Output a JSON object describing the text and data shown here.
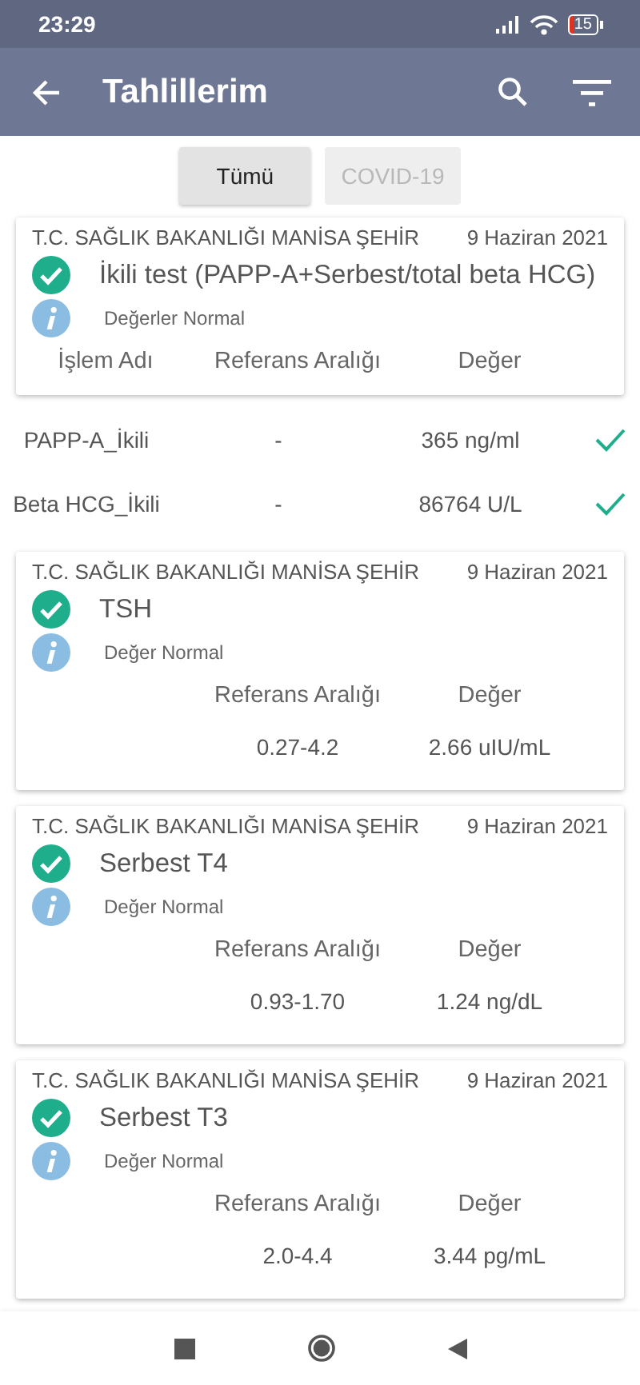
{
  "status_bar": {
    "time": "23:29",
    "battery": "15"
  },
  "app_bar": {
    "title": "Tahlillerim"
  },
  "filters": [
    {
      "label": "Tümü",
      "selected": true
    },
    {
      "label": "COVID-19",
      "selected": false
    }
  ],
  "results": [
    {
      "kind": "panel",
      "hospital": "T.C. SAĞLIK BAKANLIĞI MANİSA ŞEHİR",
      "date": "9 Haziran 2021",
      "normal": true,
      "test": "İkili test (PAPP-A+Serbest/total beta HCG)",
      "note": "Değerler Normal",
      "columns": [
        "İşlem Adı",
        "Referans Aralığı",
        "Değer"
      ],
      "rows": [
        {
          "name": "PAPP-A_İkili",
          "range": "-",
          "value": "365 ng/ml",
          "normal": true
        },
        {
          "name": "Beta HCG_İkili",
          "range": "-",
          "value": "86764 U/L",
          "normal": true
        }
      ]
    },
    {
      "kind": "single",
      "hospital": "T.C. SAĞLIK BAKANLIĞI MANİSA ŞEHİR",
      "date": "9 Haziran 2021",
      "normal": true,
      "test": "TSH",
      "note": "Değer Normal",
      "columns": [
        "Referans Aralığı",
        "Değer"
      ],
      "range": "0.27-4.2",
      "value": "2.66 uIU/mL"
    },
    {
      "kind": "single",
      "hospital": "T.C. SAĞLIK BAKANLIĞI MANİSA ŞEHİR",
      "date": "9 Haziran 2021",
      "normal": true,
      "test": "Serbest T4",
      "note": "Değer Normal",
      "columns": [
        "Referans Aralığı",
        "Değer"
      ],
      "range": "0.93-1.70",
      "value": "1.24 ng/dL"
    },
    {
      "kind": "single",
      "hospital": "T.C. SAĞLIK BAKANLIĞI MANİSA ŞEHİR",
      "date": "9 Haziran 2021",
      "normal": true,
      "test": "Serbest T3",
      "note": "Değer Normal",
      "columns": [
        "Referans Aralığı",
        "Değer"
      ],
      "range": "2.0-4.4",
      "value": "3.44 pg/mL"
    }
  ]
}
